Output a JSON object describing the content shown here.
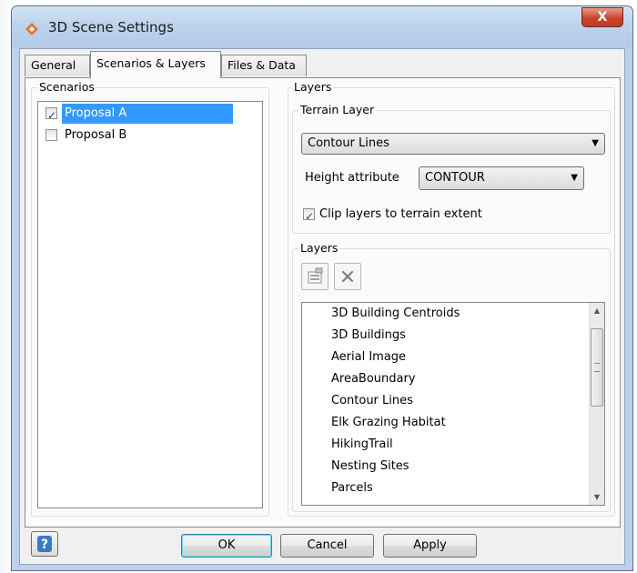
{
  "window": {
    "title": "3D Scene Settings",
    "close_label": "X"
  },
  "tabs": [
    {
      "label": "General"
    },
    {
      "label": "Scenarios & Layers",
      "active": true
    },
    {
      "label": "Files & Data"
    }
  ],
  "scenarios": {
    "heading": "Scenarios",
    "items": [
      {
        "label": "Proposal A",
        "checked": true,
        "selected": true
      },
      {
        "label": "Proposal B",
        "checked": false,
        "selected": false
      }
    ]
  },
  "layers_panel": {
    "heading": "Layers",
    "terrain": {
      "heading": "Terrain Layer",
      "selected_layer": "Contour Lines",
      "height_label": "Height attribute",
      "height_value": "CONTOUR",
      "clip_label": "Clip layers to terrain extent",
      "clip_checked": true
    },
    "layers": {
      "heading": "Layers",
      "items": [
        "3D Building Centroids",
        "3D Buildings",
        "Aerial Image",
        "AreaBoundary",
        "Contour Lines",
        "Elk Grazing Habitat",
        "HikingTrail",
        "Nesting Sites",
        "Parcels"
      ]
    }
  },
  "buttons": {
    "help": "?",
    "ok": "OK",
    "cancel": "Cancel",
    "apply": "Apply"
  },
  "icons": {
    "app": "diamond-app-icon",
    "properties": "layer-properties-icon",
    "remove": "remove-x-icon",
    "help": "help-question-icon"
  },
  "colors": {
    "selection": "#3399ff",
    "titlebar": "#bdd3ec",
    "close": "#c8452c"
  }
}
